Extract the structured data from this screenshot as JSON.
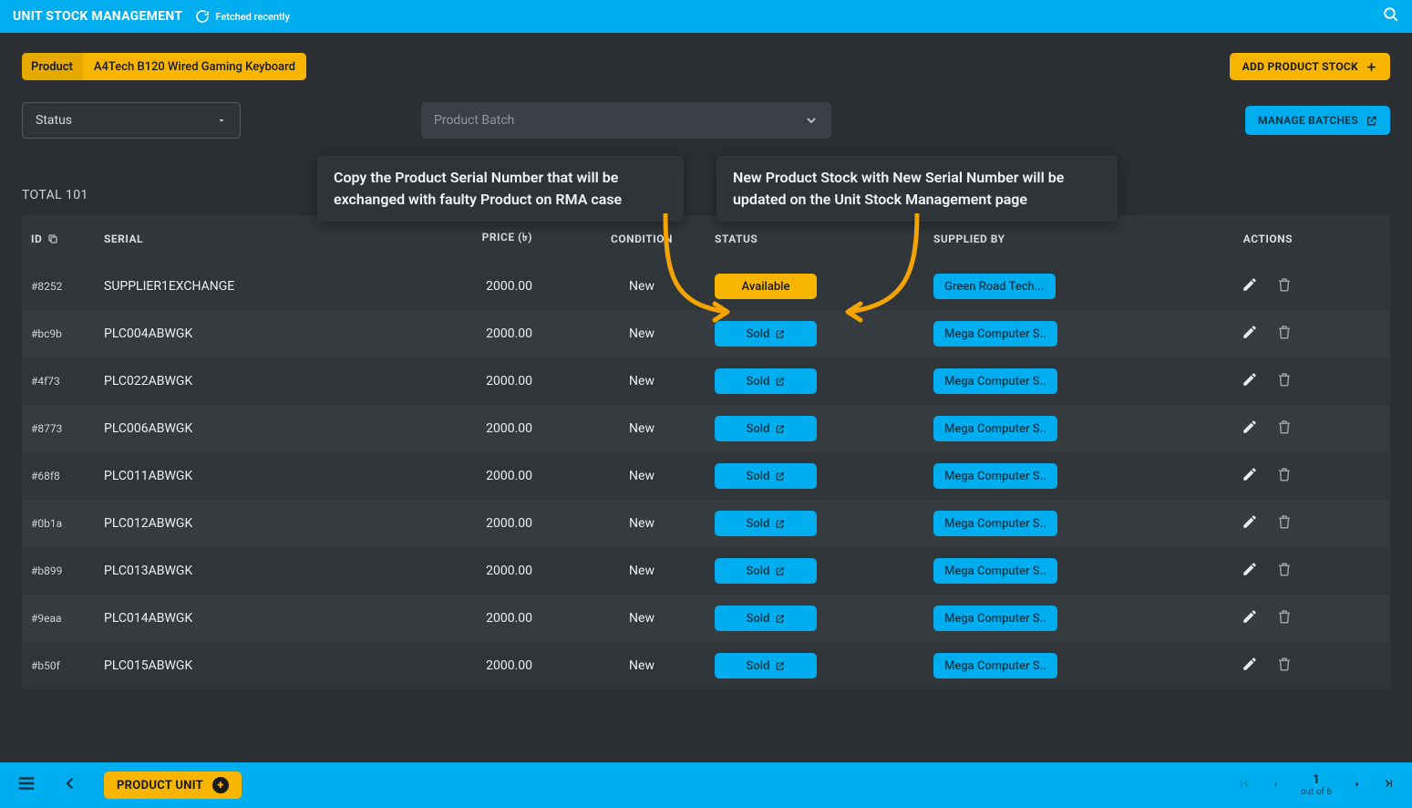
{
  "topbar": {
    "title": "UNIT STOCK MANAGEMENT",
    "fetched": "Fetched recently"
  },
  "chip": {
    "label": "Product",
    "value": "A4Tech B120 Wired Gaming Keyboard"
  },
  "buttons": {
    "add_stock": "ADD PRODUCT STOCK",
    "manage_batches": "MANAGE BATCHES",
    "crumb": "PRODUCT UNIT"
  },
  "filters": {
    "status_label": "Status",
    "batch_placeholder": "Product Batch"
  },
  "totals": {
    "label": "TOTAL 101"
  },
  "tooltips": {
    "left": "Copy the Product Serial Number that will be exchanged with faulty Product on RMA case",
    "right": "New Product Stock with New Serial Number will be updated on the Unit Stock Management page"
  },
  "columns": {
    "id": "ID",
    "serial": "SERIAL",
    "price": "PRICE (৳)",
    "condition": "CONDITION",
    "status": "STATUS",
    "supplied_by": "SUPPLIED BY",
    "actions": "ACTIONS"
  },
  "rows": [
    {
      "id": "#8252",
      "serial": "SUPPLIER1EXCHANGE",
      "price": "2000.00",
      "condition": "New",
      "status": "Available",
      "status_kind": "avail",
      "supplier": "Green Road Tech..."
    },
    {
      "id": "#bc9b",
      "serial": "PLC004ABWGK",
      "price": "2000.00",
      "condition": "New",
      "status": "Sold",
      "status_kind": "sold",
      "supplier": "Mega Computer S.."
    },
    {
      "id": "#4f73",
      "serial": "PLC022ABWGK",
      "price": "2000.00",
      "condition": "New",
      "status": "Sold",
      "status_kind": "sold",
      "supplier": "Mega Computer S.."
    },
    {
      "id": "#8773",
      "serial": "PLC006ABWGK",
      "price": "2000.00",
      "condition": "New",
      "status": "Sold",
      "status_kind": "sold",
      "supplier": "Mega Computer S.."
    },
    {
      "id": "#68f8",
      "serial": "PLC011ABWGK",
      "price": "2000.00",
      "condition": "New",
      "status": "Sold",
      "status_kind": "sold",
      "supplier": "Mega Computer S.."
    },
    {
      "id": "#0b1a",
      "serial": "PLC012ABWGK",
      "price": "2000.00",
      "condition": "New",
      "status": "Sold",
      "status_kind": "sold",
      "supplier": "Mega Computer S.."
    },
    {
      "id": "#b899",
      "serial": "PLC013ABWGK",
      "price": "2000.00",
      "condition": "New",
      "status": "Sold",
      "status_kind": "sold",
      "supplier": "Mega Computer S.."
    },
    {
      "id": "#9eaa",
      "serial": "PLC014ABWGK",
      "price": "2000.00",
      "condition": "New",
      "status": "Sold",
      "status_kind": "sold",
      "supplier": "Mega Computer S.."
    },
    {
      "id": "#b50f",
      "serial": "PLC015ABWGK",
      "price": "2000.00",
      "condition": "New",
      "status": "Sold",
      "status_kind": "sold",
      "supplier": "Mega Computer S.."
    }
  ],
  "pager": {
    "page": "1",
    "of": "out of 6"
  }
}
